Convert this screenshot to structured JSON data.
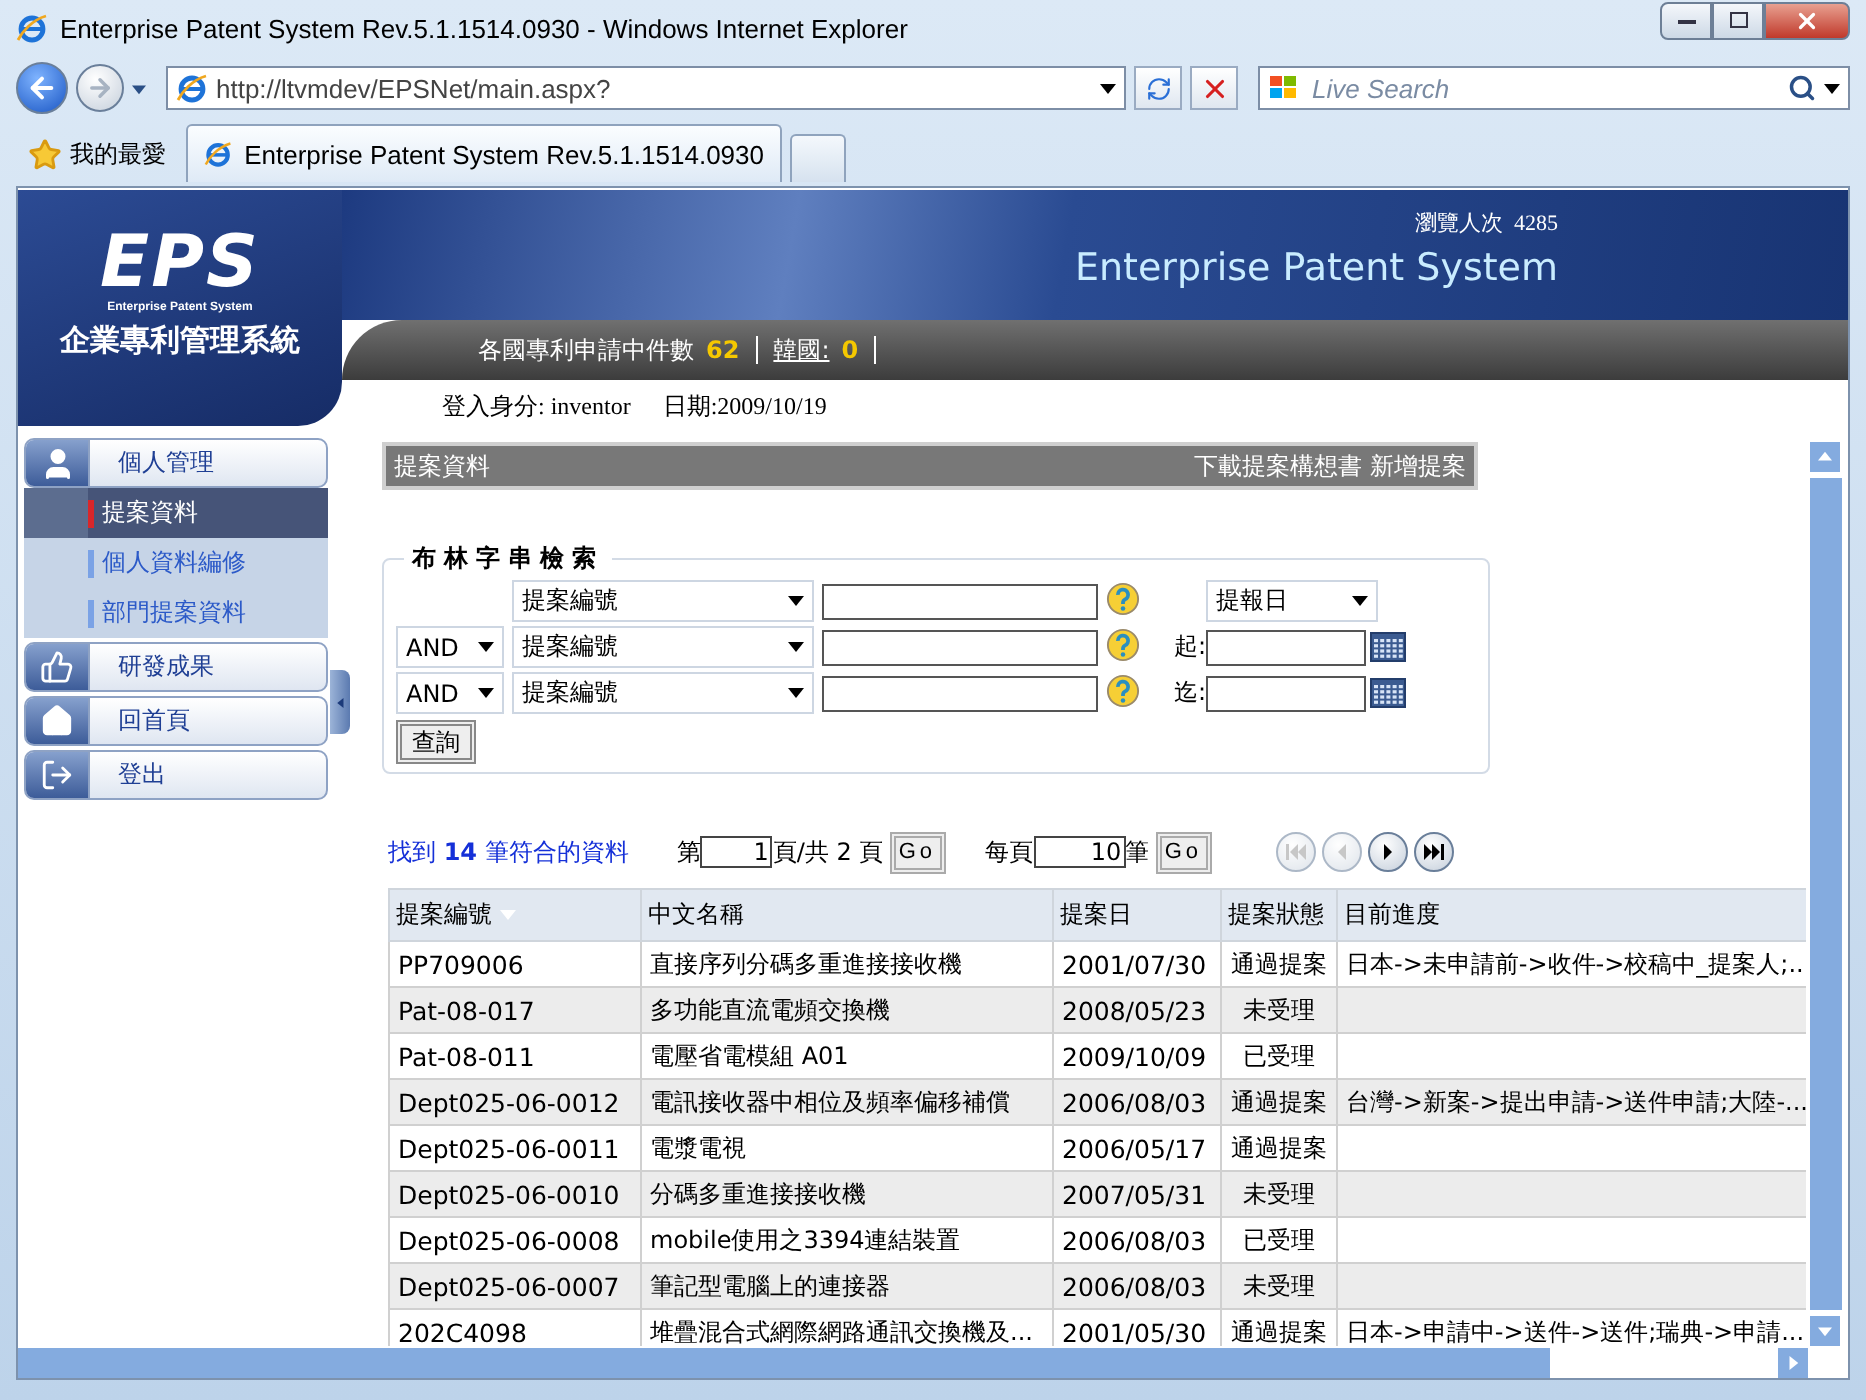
{
  "window": {
    "title": "Enterprise Patent System Rev.5.1.1514.0930 - Windows Internet Explorer"
  },
  "address_bar": {
    "url": "http://ltvmdev/EPSNet/main.aspx?"
  },
  "search": {
    "placeholder": "Live Search"
  },
  "favorites": {
    "label": "我的最愛"
  },
  "tabs": [
    {
      "label": "Enterprise Patent System Rev.5.1.1514.0930",
      "selected": true
    }
  ],
  "header": {
    "logo": "EPS",
    "logo_caption": "Enterprise Patent System",
    "logo_title": "企業專利管理系統",
    "visits_label": "瀏覽人次",
    "visits": "4285",
    "banner_title": "Enterprise Patent System",
    "stats": [
      {
        "label": "各國專利申請中件數",
        "value": "62",
        "link": false
      },
      {
        "label": "韓國:",
        "value": "0",
        "link": true
      }
    ],
    "user": "登入身分: inventor",
    "date": "日期:2009/10/19"
  },
  "sidebar": {
    "items": [
      {
        "label": "個人管理",
        "kind": "person",
        "children": [
          {
            "label": "提案資料",
            "selected": true
          },
          {
            "label": "個人資料編修",
            "selected": false
          },
          {
            "label": "部門提案資料",
            "selected": false
          }
        ]
      },
      {
        "label": "研發成果",
        "kind": "thumb"
      },
      {
        "label": "回首頁",
        "kind": "home"
      },
      {
        "label": "登出",
        "kind": "exit"
      }
    ]
  },
  "panel": {
    "title": "提案資料",
    "actions": [
      "下載提案構想書",
      "新增提案"
    ]
  },
  "boolean_search": {
    "legend": "布林字串檢索",
    "rows": [
      {
        "field": "提案編號"
      },
      {
        "operator": "AND",
        "field": "提案編號"
      },
      {
        "operator": "AND",
        "field": "提案編號"
      }
    ],
    "date_field": "提報日",
    "from_label": "起:",
    "to_label": "迄:",
    "button": "查詢"
  },
  "results": {
    "summary": "找到 **14** 筆符合的資料",
    "page_prefix": "第",
    "page": "1",
    "page_suffix": "頁/共 2 頁",
    "go": "Go",
    "per_page_prefix": "每頁",
    "per_page": "10",
    "per_page_suffix": "筆",
    "go2": "Go",
    "nav_buttons": [
      {
        "kind": "first",
        "disabled": true
      },
      {
        "kind": "prev",
        "disabled": true
      },
      {
        "kind": "next",
        "disabled": false
      },
      {
        "kind": "last",
        "disabled": false
      }
    ]
  },
  "table": {
    "columns": [
      {
        "label": "提案編號",
        "sorted": true
      },
      {
        "label": "中文名稱",
        "sorted": false
      },
      {
        "label": "提案日",
        "sorted": false
      },
      {
        "label": "提案狀態",
        "sorted": false
      },
      {
        "label": "目前進度",
        "sorted": false
      }
    ],
    "rows": [
      {
        "id": "PP709006",
        "name": "直接序列分碼多重進接接收機",
        "date": "2001/07/30",
        "status": "通過提案",
        "progress": "日本->未申請前->收件->校稿中_提案人;..."
      },
      {
        "id": "Pat-08-017",
        "name": "多功能直流電頻交換機",
        "date": "2008/05/23",
        "status": "未受理"
      },
      {
        "id": "Pat-08-011",
        "name": "電壓省電模組 A01",
        "date": "2009/10/09",
        "status": "已受理"
      },
      {
        "id": "Dept025-06-0012",
        "name": "電訊接收器中相位及頻率偏移補償",
        "date": "2006/08/03",
        "status": "通過提案",
        "progress": "台灣->新案->提出申請->送件申請;大陸-..."
      },
      {
        "id": "Dept025-06-0011",
        "name": "電漿電視",
        "date": "2006/05/17",
        "status": "通過提案"
      },
      {
        "id": "Dept025-06-0010",
        "name": "分碼多重進接接收機",
        "date": "2007/05/31",
        "status": "未受理"
      },
      {
        "id": "Dept025-06-0008",
        "name": "mobile使用之3394連結裝置",
        "date": "2006/08/03",
        "status": "已受理"
      },
      {
        "id": "Dept025-06-0007",
        "name": "筆記型電腦上的連接器",
        "date": "2006/08/03",
        "status": "未受理"
      },
      {
        "id": "202C4098",
        "name": "堆疊混合式網際網路通訊交換機及...",
        "date": "2001/05/30",
        "status": "通過提案",
        "progress": "日本->申請中->送件->送件;瑞典->申請..."
      }
    ]
  }
}
